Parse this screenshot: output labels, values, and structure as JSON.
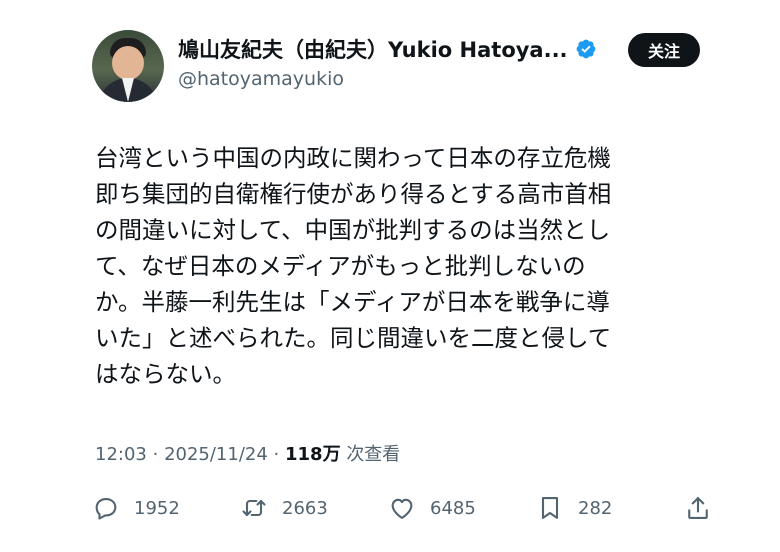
{
  "author": {
    "display_name": "鳩山友紀夫（由紀夫）Yukio Hatoya...",
    "handle": "@hatoyamayukio",
    "verified": true
  },
  "follow_label": "关注",
  "tweet": {
    "lines": [
      "台湾という中国の内政に関わって日本の存立危機",
      "即ち集団的自衛権行使があり得るとする高市首相",
      "の間違いに対して、中国が批判するのは当然とし",
      "て、なぜ日本のメディアがもっと批判しないの",
      "か。半藤一利先生は「メディアが日本を戦争に導",
      "いた」と述べられた。同じ間違いを二度と侵して",
      "はならない。"
    ]
  },
  "meta": {
    "time": "12:03",
    "date": "2025/11/24",
    "views_count": "118万",
    "views_label": "次查看"
  },
  "actions": {
    "replies": "1952",
    "retweets": "2663",
    "likes": "6485",
    "bookmarks": "282"
  },
  "colors": {
    "text": "#0f1419",
    "secondary": "#536471",
    "verified": "#1d9bf0",
    "follow_bg": "#0f1419"
  },
  "icons": [
    "verified-badge-icon",
    "reply-icon",
    "retweet-icon",
    "like-icon",
    "bookmark-icon",
    "share-icon"
  ]
}
